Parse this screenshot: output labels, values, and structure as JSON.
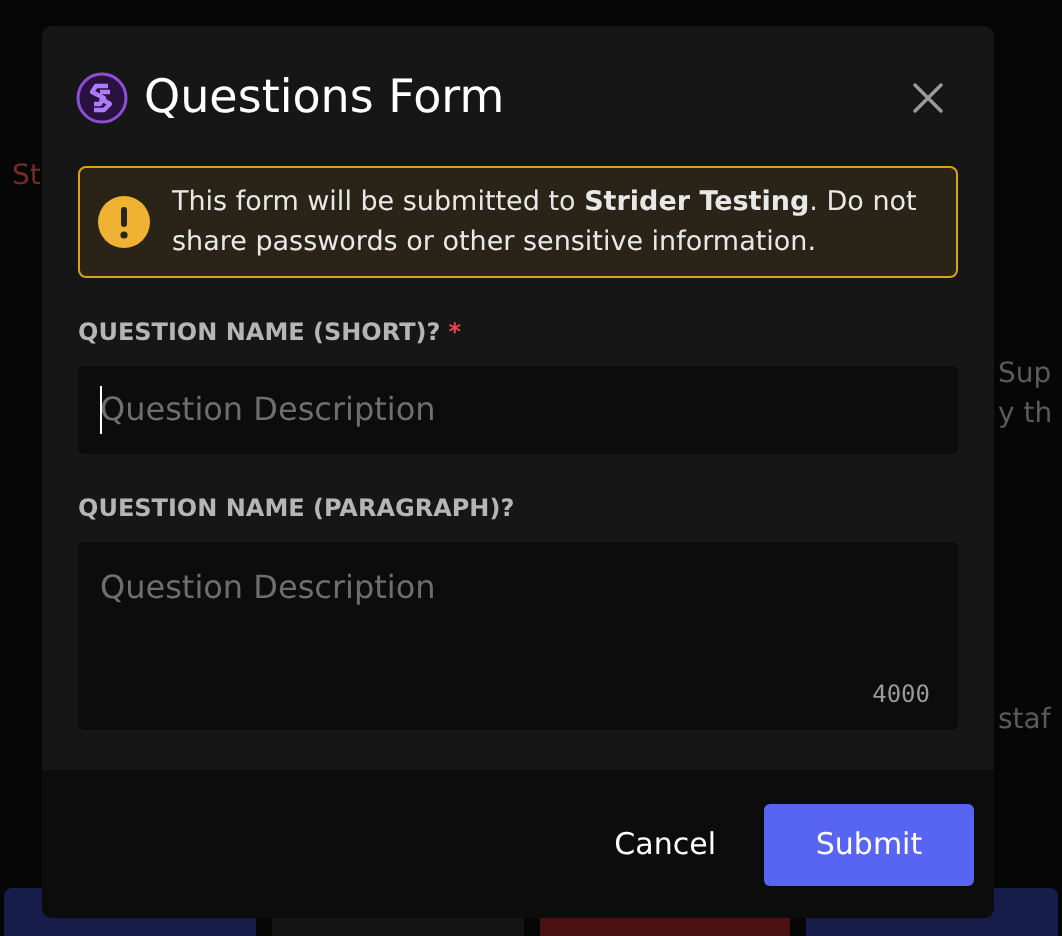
{
  "background": {
    "fragments": [
      "St",
      "Sup",
      "y th",
      "staf"
    ],
    "buttons": [
      {
        "color": "#161d4a"
      },
      {
        "color": "#141414"
      },
      {
        "color": "#4a1212"
      },
      {
        "color": "#161d4a"
      }
    ]
  },
  "modal": {
    "title": "Questions Form",
    "notice": "This form will be submitted to **Strider Testing**. Do not share passwords or other sensitive information.",
    "fields": [
      {
        "kind": "short",
        "label": "QUESTION NAME (SHORT)?",
        "required_mark": "*",
        "placeholder": "Question Description",
        "focused": true
      },
      {
        "kind": "paragraph",
        "label": "QUESTION NAME (PARAGRAPH)?",
        "placeholder": "Question Description",
        "counter": "4000",
        "focused": false
      }
    ],
    "buttons": [
      {
        "label": "Cancel",
        "kind": "link"
      },
      {
        "label": "Submit",
        "kind": "primary"
      }
    ]
  }
}
